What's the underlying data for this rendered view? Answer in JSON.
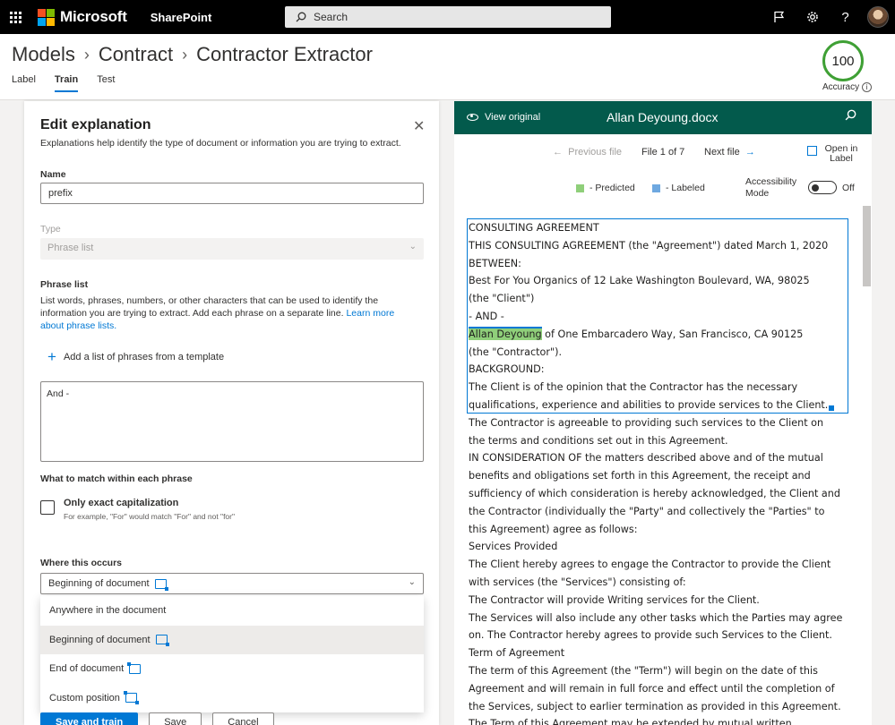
{
  "topbar": {
    "brand": "Microsoft",
    "app": "SharePoint",
    "search_placeholder": "Search",
    "brand_colors": [
      "#f25022",
      "#7fba00",
      "#00a4ef",
      "#ffb900"
    ]
  },
  "header": {
    "breadcrumb": [
      "Models",
      "Contract",
      "Contractor Extractor"
    ],
    "tabs": [
      {
        "label": "Label",
        "active": false
      },
      {
        "label": "Train",
        "active": true
      },
      {
        "label": "Test",
        "active": false
      }
    ],
    "accuracy_value": "100",
    "accuracy_label": "Accuracy"
  },
  "panel": {
    "title": "Edit explanation",
    "description": "Explanations help identify the type of document or information you are trying to extract.",
    "name_label": "Name",
    "name_value": "prefix",
    "type_label": "Type",
    "type_value": "Phrase list",
    "phrase_list_label": "Phrase list",
    "phrase_list_desc": "List words, phrases, numbers, or other characters that can be used to identify the information you are trying to extract. Add each phrase on a separate line.",
    "learn_more": "Learn more about phrase lists.",
    "add_template": "Add a list of phrases from a template",
    "phrases_value": "And -",
    "match_label": "What to match within each phrase",
    "exact_cap_label": "Only exact capitalization",
    "exact_cap_sub": "For example, \"For\" would match \"For\" and not \"for\"",
    "exact_cap_checked": false,
    "where_label": "Where this occurs",
    "where_value": "Beginning of document",
    "where_options": [
      {
        "label": "Anywhere in the document",
        "icon": "",
        "selected": false
      },
      {
        "label": "Beginning of document",
        "icon": "doc-beginning-icon",
        "selected": true
      },
      {
        "label": "End of document",
        "icon": "doc-end-icon",
        "selected": false
      },
      {
        "label": "Custom position",
        "icon": "doc-custom-icon",
        "selected": false
      }
    ],
    "buttons": {
      "save_train": "Save and train",
      "save": "Save",
      "cancel": "Cancel"
    }
  },
  "viewer": {
    "view_original": "View original",
    "file_name": "Allan Deyoung.docx",
    "previous": "Previous file",
    "file_count": "File 1 of 7",
    "next": "Next file",
    "open_in_label": "Open in Label",
    "legend_predicted": "- Predicted",
    "legend_labeled": "- Labeled",
    "predicted_color": "#8fcf7a",
    "labeled_color": "#6ea8e0",
    "accessibility_label": "Accessibility Mode",
    "accessibility_state": "Off",
    "highlight_text": "Allan Deyoung",
    "highlight_rest": " of One Embarcadero Way, San Francisco, CA 90125",
    "lines": [
      "CONSULTING AGREEMENT",
      "THIS CONSULTING AGREEMENT (the \"Agreement\") dated March 1, 2020",
      "BETWEEN:",
      "Best For You Organics of 12 Lake Washington Boulevard, WA, 98025",
      "(the \"Client\")",
      "- AND -",
      "__HIGHLIGHT__",
      "(the \"Contractor\").",
      "BACKGROUND:",
      "The Client is of the opinion that the Contractor has the necessary",
      "qualifications, experience and abilities to provide services to the Client.",
      "The Contractor is agreeable to providing such services to the Client on",
      "the terms and conditions set out in this Agreement.",
      "IN CONSIDERATION OF the matters described above and of the mutual",
      "benefits and obligations set forth in this Agreement, the receipt and",
      "sufficiency of which consideration is hereby acknowledged, the Client and",
      "the Contractor (individually the \"Party\" and collectively the \"Parties\" to",
      "this Agreement) agree as follows:",
      "Services Provided",
      "The Client hereby agrees to engage the Contractor to provide the Client",
      "with services (the \"Services\") consisting of:",
      "The Contractor will provide Writing services for the Client.",
      "The Services will also include any other tasks which the Parties may agree",
      "on. The Contractor hereby agrees to provide such Services to the Client.",
      "Term of Agreement",
      "The term of this Agreement (the \"Term\") will begin on the date of this",
      "Agreement and will remain in full force and effect until the completion of",
      "the Services, subject to earlier termination as provided in this Agreement.",
      "The Term of this Agreement may be extended by mutual written"
    ]
  }
}
